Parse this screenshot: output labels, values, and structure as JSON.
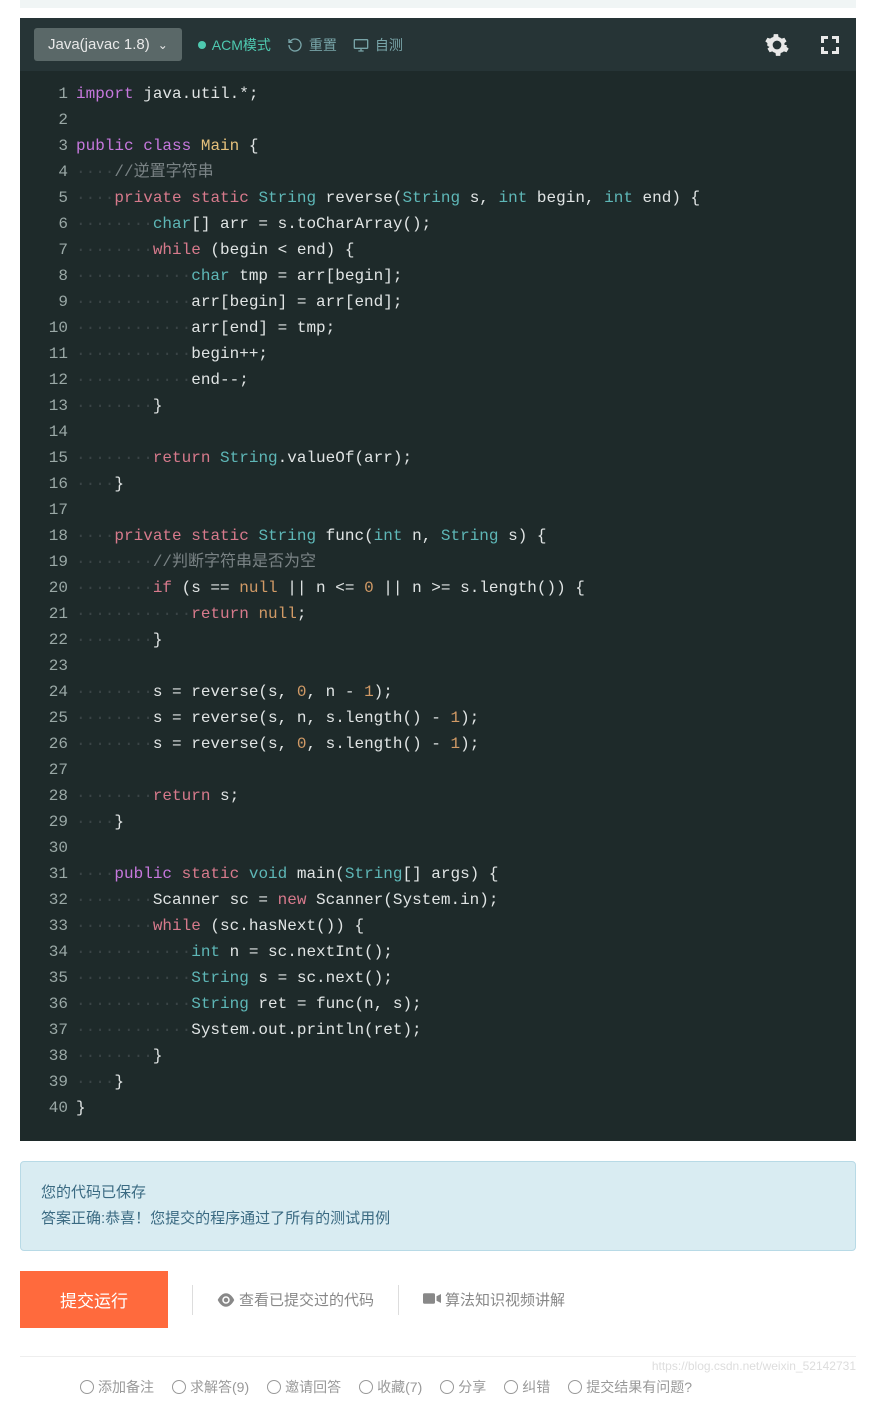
{
  "toolbar": {
    "language": "Java(javac 1.8)",
    "mode": "ACM模式",
    "reset": "重置",
    "selftest": "自测"
  },
  "code": [
    {
      "n": 1,
      "tokens": [
        {
          "t": "import",
          "c": "kw"
        },
        {
          "t": " ",
          "c": ""
        },
        {
          "t": "java.util.*;",
          "c": ""
        }
      ]
    },
    {
      "n": 2,
      "tokens": []
    },
    {
      "n": 3,
      "tokens": [
        {
          "t": "public",
          "c": "kw"
        },
        {
          "t": " ",
          "c": ""
        },
        {
          "t": "class",
          "c": "kw"
        },
        {
          "t": " ",
          "c": ""
        },
        {
          "t": "Main",
          "c": "name"
        },
        {
          "t": " {",
          "c": ""
        }
      ]
    },
    {
      "n": 4,
      "tokens": [
        {
          "t": "····",
          "c": "dots"
        },
        {
          "t": "//逆置字符串",
          "c": "com"
        }
      ]
    },
    {
      "n": 5,
      "tokens": [
        {
          "t": "····",
          "c": "dots"
        },
        {
          "t": "private",
          "c": "kw2"
        },
        {
          "t": " ",
          "c": ""
        },
        {
          "t": "static",
          "c": "kw2"
        },
        {
          "t": " ",
          "c": ""
        },
        {
          "t": "String",
          "c": "type"
        },
        {
          "t": " reverse(",
          "c": ""
        },
        {
          "t": "String",
          "c": "type"
        },
        {
          "t": " s, ",
          "c": ""
        },
        {
          "t": "int",
          "c": "type"
        },
        {
          "t": " begin, ",
          "c": ""
        },
        {
          "t": "int",
          "c": "type"
        },
        {
          "t": " end) {",
          "c": ""
        }
      ]
    },
    {
      "n": 6,
      "tokens": [
        {
          "t": "········",
          "c": "dots"
        },
        {
          "t": "char",
          "c": "type"
        },
        {
          "t": "[] arr = s.toCharArray();",
          "c": ""
        }
      ]
    },
    {
      "n": 7,
      "tokens": [
        {
          "t": "········",
          "c": "dots"
        },
        {
          "t": "while",
          "c": "kw2"
        },
        {
          "t": " (begin < end) {",
          "c": ""
        }
      ]
    },
    {
      "n": 8,
      "tokens": [
        {
          "t": "············",
          "c": "dots"
        },
        {
          "t": "char",
          "c": "type"
        },
        {
          "t": " tmp = arr[begin];",
          "c": ""
        }
      ]
    },
    {
      "n": 9,
      "tokens": [
        {
          "t": "············",
          "c": "dots"
        },
        {
          "t": "arr[begin] = arr[end];",
          "c": ""
        }
      ]
    },
    {
      "n": 10,
      "tokens": [
        {
          "t": "············",
          "c": "dots"
        },
        {
          "t": "arr[end] = tmp;",
          "c": ""
        }
      ]
    },
    {
      "n": 11,
      "tokens": [
        {
          "t": "············",
          "c": "dots"
        },
        {
          "t": "begin++;",
          "c": ""
        }
      ]
    },
    {
      "n": 12,
      "tokens": [
        {
          "t": "············",
          "c": "dots"
        },
        {
          "t": "end--;",
          "c": ""
        }
      ]
    },
    {
      "n": 13,
      "tokens": [
        {
          "t": "········",
          "c": "dots"
        },
        {
          "t": "}",
          "c": ""
        }
      ]
    },
    {
      "n": 14,
      "tokens": []
    },
    {
      "n": 15,
      "tokens": [
        {
          "t": "········",
          "c": "dots"
        },
        {
          "t": "return",
          "c": "ret"
        },
        {
          "t": " ",
          "c": ""
        },
        {
          "t": "String",
          "c": "type"
        },
        {
          "t": ".valueOf(arr);",
          "c": ""
        }
      ]
    },
    {
      "n": 16,
      "tokens": [
        {
          "t": "····",
          "c": "dots"
        },
        {
          "t": "}",
          "c": ""
        }
      ]
    },
    {
      "n": 17,
      "tokens": []
    },
    {
      "n": 18,
      "tokens": [
        {
          "t": "····",
          "c": "dots"
        },
        {
          "t": "private",
          "c": "kw2"
        },
        {
          "t": " ",
          "c": ""
        },
        {
          "t": "static",
          "c": "kw2"
        },
        {
          "t": " ",
          "c": ""
        },
        {
          "t": "String",
          "c": "type"
        },
        {
          "t": " func(",
          "c": ""
        },
        {
          "t": "int",
          "c": "type"
        },
        {
          "t": " n, ",
          "c": ""
        },
        {
          "t": "String",
          "c": "type"
        },
        {
          "t": " s) {",
          "c": ""
        }
      ]
    },
    {
      "n": 19,
      "tokens": [
        {
          "t": "········",
          "c": "dots"
        },
        {
          "t": "//判断字符串是否为空",
          "c": "com"
        }
      ]
    },
    {
      "n": 20,
      "tokens": [
        {
          "t": "········",
          "c": "dots"
        },
        {
          "t": "if",
          "c": "kw2"
        },
        {
          "t": " (s == ",
          "c": ""
        },
        {
          "t": "null",
          "c": "num"
        },
        {
          "t": " || n <= ",
          "c": ""
        },
        {
          "t": "0",
          "c": "num"
        },
        {
          "t": " || n >= s.length()) {",
          "c": ""
        }
      ]
    },
    {
      "n": 21,
      "tokens": [
        {
          "t": "············",
          "c": "dots"
        },
        {
          "t": "return",
          "c": "ret"
        },
        {
          "t": " ",
          "c": ""
        },
        {
          "t": "null",
          "c": "num"
        },
        {
          "t": ";",
          "c": ""
        }
      ]
    },
    {
      "n": 22,
      "tokens": [
        {
          "t": "········",
          "c": "dots"
        },
        {
          "t": "}",
          "c": ""
        }
      ]
    },
    {
      "n": 23,
      "tokens": []
    },
    {
      "n": 24,
      "tokens": [
        {
          "t": "········",
          "c": "dots"
        },
        {
          "t": "s = reverse(s, ",
          "c": ""
        },
        {
          "t": "0",
          "c": "num"
        },
        {
          "t": ", n - ",
          "c": ""
        },
        {
          "t": "1",
          "c": "num"
        },
        {
          "t": ");",
          "c": ""
        }
      ]
    },
    {
      "n": 25,
      "tokens": [
        {
          "t": "········",
          "c": "dots"
        },
        {
          "t": "s = reverse(s, n, s.length() - ",
          "c": ""
        },
        {
          "t": "1",
          "c": "num"
        },
        {
          "t": ");",
          "c": ""
        }
      ]
    },
    {
      "n": 26,
      "tokens": [
        {
          "t": "········",
          "c": "dots"
        },
        {
          "t": "s = reverse(s, ",
          "c": ""
        },
        {
          "t": "0",
          "c": "num"
        },
        {
          "t": ", s.length() - ",
          "c": ""
        },
        {
          "t": "1",
          "c": "num"
        },
        {
          "t": ");",
          "c": ""
        }
      ]
    },
    {
      "n": 27,
      "tokens": []
    },
    {
      "n": 28,
      "tokens": [
        {
          "t": "········",
          "c": "dots"
        },
        {
          "t": "return",
          "c": "ret"
        },
        {
          "t": " s;",
          "c": ""
        }
      ]
    },
    {
      "n": 29,
      "tokens": [
        {
          "t": "····",
          "c": "dots"
        },
        {
          "t": "}",
          "c": ""
        }
      ]
    },
    {
      "n": 30,
      "tokens": []
    },
    {
      "n": 31,
      "tokens": [
        {
          "t": "····",
          "c": "dots"
        },
        {
          "t": "public",
          "c": "kw"
        },
        {
          "t": " ",
          "c": ""
        },
        {
          "t": "static",
          "c": "kw2"
        },
        {
          "t": " ",
          "c": ""
        },
        {
          "t": "void",
          "c": "type"
        },
        {
          "t": " main(",
          "c": ""
        },
        {
          "t": "String",
          "c": "type"
        },
        {
          "t": "[] args) {",
          "c": ""
        }
      ]
    },
    {
      "n": 32,
      "tokens": [
        {
          "t": "········",
          "c": "dots"
        },
        {
          "t": "Scanner sc = ",
          "c": ""
        },
        {
          "t": "new",
          "c": "kw2"
        },
        {
          "t": " Scanner(System.in);",
          "c": ""
        }
      ]
    },
    {
      "n": 33,
      "tokens": [
        {
          "t": "········",
          "c": "dots"
        },
        {
          "t": "while",
          "c": "kw2"
        },
        {
          "t": " (sc.hasNext()) {",
          "c": ""
        }
      ]
    },
    {
      "n": 34,
      "tokens": [
        {
          "t": "············",
          "c": "dots"
        },
        {
          "t": "int",
          "c": "type"
        },
        {
          "t": " n = sc.nextInt();",
          "c": ""
        }
      ]
    },
    {
      "n": 35,
      "tokens": [
        {
          "t": "············",
          "c": "dots"
        },
        {
          "t": "String",
          "c": "type"
        },
        {
          "t": " s = sc.next();",
          "c": ""
        }
      ]
    },
    {
      "n": 36,
      "tokens": [
        {
          "t": "············",
          "c": "dots"
        },
        {
          "t": "String",
          "c": "type"
        },
        {
          "t": " ret = func(n, s);",
          "c": ""
        }
      ]
    },
    {
      "n": 37,
      "tokens": [
        {
          "t": "············",
          "c": "dots"
        },
        {
          "t": "System.out.println(ret);",
          "c": ""
        }
      ]
    },
    {
      "n": 38,
      "tokens": [
        {
          "t": "········",
          "c": "dots"
        },
        {
          "t": "}",
          "c": ""
        }
      ]
    },
    {
      "n": 39,
      "tokens": [
        {
          "t": "····",
          "c": "dots"
        },
        {
          "t": "}",
          "c": ""
        }
      ]
    },
    {
      "n": 40,
      "tokens": [
        {
          "t": "}",
          "c": ""
        }
      ]
    }
  ],
  "alert": {
    "line1": "您的代码已保存",
    "line2": "答案正确:恭喜！您提交的程序通过了所有的测试用例"
  },
  "bottom": {
    "submit": "提交运行",
    "history": "查看已提交过的代码",
    "video": "算法知识视频讲解"
  },
  "watermark": "https://blog.csdn.net/weixin_52142731",
  "footer": {
    "a": "添加备注",
    "b": "求解答(9)",
    "c": "邀请回答",
    "d": "收藏(7)",
    "e": "分享",
    "f": "纠错",
    "g": "提交结果有问题?"
  }
}
